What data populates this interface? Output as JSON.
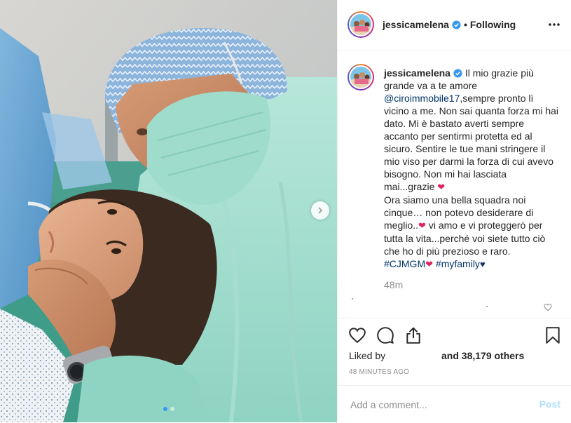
{
  "post": {
    "username": "jessicamelena",
    "separator": "•",
    "follow_status": "Following",
    "caption": {
      "author": "jessicamelena",
      "line1": "Il mio grazie più grande va a te amore",
      "mention": "@ciroimmobile17",
      "line2": ",sempre pronto lì vicino a me. Non sai quanta forza mi hai dato. Mi è bastato averti sempre accanto per sentirmi protetta ed al sicuro. Sentire le tue mani stringere il mio viso per darmi la forza di cui avevo bisogno. Non mi hai lasciata mai...grazie",
      "line3": "Ora siamo una bella squadra noi cinque… non potevo desiderare di meglio..",
      "line4": "vi amo e vi proteggerò per tutta la vita...perché voi siete tutto ciò che ho di più prezioso e raro.",
      "hashtag1": "#CJMGM",
      "hashtag2": "#myfamily",
      "heart": "❤",
      "heart_navy": "♥"
    },
    "time_ago": "48m",
    "liked_by_label": "Liked by",
    "likes_text": "and 38,179 others",
    "timestamp": "48 MINUTES AGO",
    "comment_placeholder": "Add a comment...",
    "post_button": "Post",
    "carousel": {
      "total": 2,
      "active": 1
    },
    "icons": {
      "verified": "verified-badge-icon",
      "more": "more-options-icon",
      "like": "heart-icon",
      "comment": "comment-icon",
      "share": "share-icon",
      "save": "bookmark-icon",
      "next": "chevron-right-icon"
    },
    "colors": {
      "link": "#003569",
      "verified": "#3897f0",
      "heart": "#e0245e",
      "post_disabled": "#b2dffc",
      "muted": "#8e8e8e"
    }
  }
}
